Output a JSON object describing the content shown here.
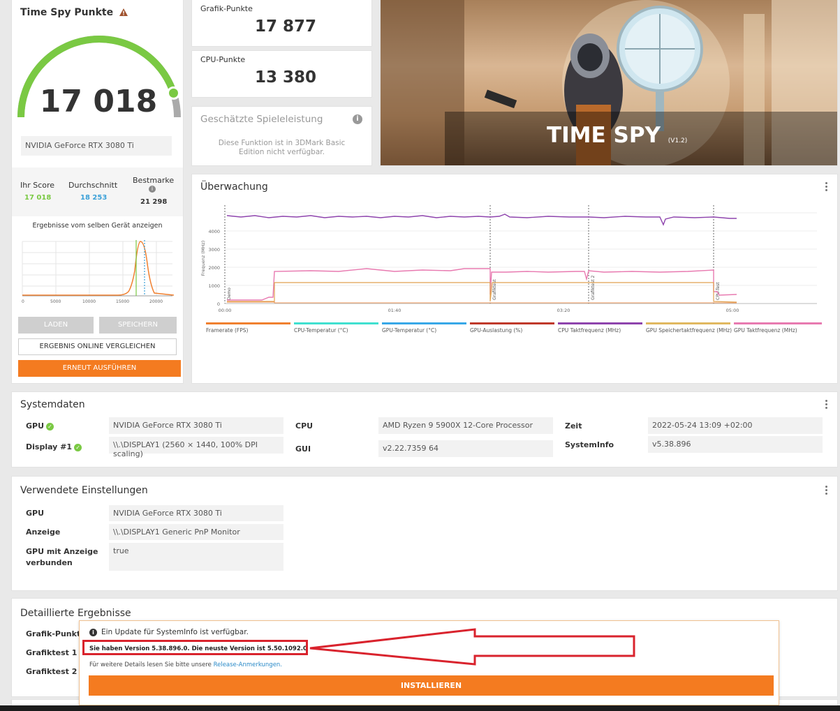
{
  "score_panel": {
    "title": "Time Spy Punkte",
    "score": "17 018",
    "gpu_name": "NVIDIA GeForce RTX 3080 Ti",
    "gauge_level": 0.9,
    "stats": {
      "your_label": "Ihr Score",
      "your_value": "17 018",
      "avg_label": "Durchschnitt",
      "avg_value": "18 253",
      "best_label": "Bestmarke",
      "best_value": "21 298"
    },
    "same_device_label": "Ergebnisse vom selben Gerät anzeigen",
    "dist_ticks": [
      "0",
      "5000",
      "10000",
      "15000",
      "20000"
    ],
    "load_label": "LADEN",
    "save_label": "SPEICHERN",
    "compare_label": "ERGEBNIS ONLINE VERGLEICHEN",
    "rerun_label": "ERNEUT AUSFÜHREN"
  },
  "graphics_score": {
    "label": "Grafik-Punkte",
    "value": "17 877"
  },
  "cpu_score": {
    "label": "CPU-Punkte",
    "value": "13 380"
  },
  "estimate": {
    "title": "Geschätzte Spieleleistung",
    "message": "Diese Funktion ist in 3DMark Basic Edition nicht verfügbar."
  },
  "hero": {
    "title": "TIME SPY",
    "version": "(V1.2)"
  },
  "monitoring": {
    "title": "Überwachung",
    "y_axis_label": "Frequenz (MHz)",
    "y_ticks": [
      "0",
      "1000",
      "2000",
      "3000",
      "4000"
    ],
    "x_ticks": [
      "00:00",
      "01:40",
      "03:20",
      "05:00"
    ],
    "markers": [
      "Demo",
      "Grafiktest",
      "Grafiktest 2",
      "CPU-Test"
    ],
    "legend": [
      {
        "label": "Framerate (FPS)",
        "color": "#f08030"
      },
      {
        "label": "CPU-Temperatur (°C)",
        "color": "#40e0d0"
      },
      {
        "label": "GPU-Temperatur (°C)",
        "color": "#38a8e8"
      },
      {
        "label": "GPU-Auslastung (%)",
        "color": "#c0392b"
      },
      {
        "label": "CPU Taktfrequenz (MHz)",
        "color": "#8e44ad"
      },
      {
        "label": "GPU Speichertaktfrequenz (MHz)",
        "color": "#e0b860"
      },
      {
        "label": "GPU Taktfrequenz (MHz)",
        "color": "#e87ab0"
      }
    ]
  },
  "system": {
    "title": "Systemdaten",
    "gpu_label": "GPU",
    "gpu_value": "NVIDIA GeForce RTX 3080 Ti",
    "display_label": "Display #1",
    "display_value": "\\\\.\\DISPLAY1 (2560 × 1440, 100% DPI scaling)",
    "cpu_label": "CPU",
    "cpu_value": "AMD Ryzen 9 5900X 12-Core Processor",
    "gui_label": "GUI",
    "gui_value": "v2.22.7359 64",
    "time_label": "Zeit",
    "time_value": "2022-05-24 13:09 +02:00",
    "sysinfo_label": "SystemInfo",
    "sysinfo_value": "v5.38.896"
  },
  "settings": {
    "title": "Verwendete Einstellungen",
    "gpu_label": "GPU",
    "gpu_value": "NVIDIA GeForce RTX 3080 Ti",
    "display_label": "Anzeige",
    "display_value": "\\\\.\\DISPLAY1 Generic PnP Monitor",
    "connected_label": "GPU mit Anzeige verbunden",
    "connected_value": "true"
  },
  "detailed": {
    "title": "Detaillierte Ergebnisse",
    "rows": [
      "Grafik-Punkte",
      "Grafiktest 1",
      "Grafiktest 2"
    ]
  },
  "update_popup": {
    "info": "Ein Update für SystemInfo ist verfügbar.",
    "version_msg": "Sie haben Version 5.38.896.0. Die neuste Version ist 5.50.1092.0",
    "details_prefix": "Für weitere Details lesen Sie bitte unsere",
    "details_link": "Release-Anmerkungen.",
    "install_label": "INSTALLIEREN"
  },
  "colors": {
    "accent_orange": "#f47b20",
    "score_green": "#7ac943",
    "avg_blue": "#3aa0d8",
    "annotation_red": "#d9232d"
  }
}
